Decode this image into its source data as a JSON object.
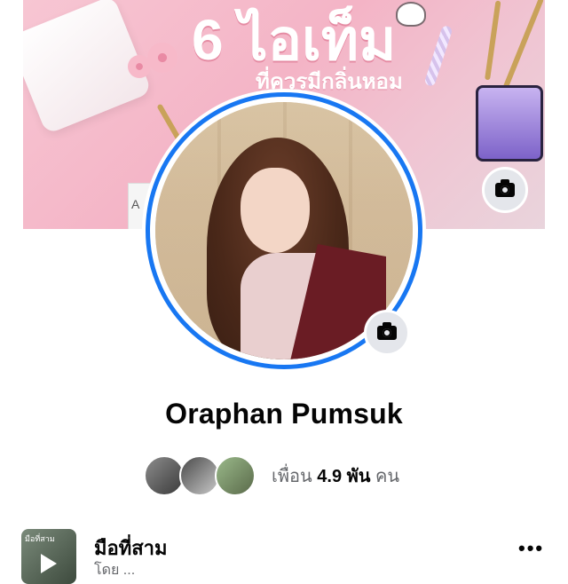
{
  "cover": {
    "headline": "6 ไอเท็ม",
    "subline": "ที่ควรมีกลิ่นหอม",
    "card_text": "A"
  },
  "profile": {
    "name": "Oraphan Pumsuk"
  },
  "friends": {
    "prefix": "เพื่อน",
    "count": "4.9 พัน",
    "suffix": "คน"
  },
  "post": {
    "title": "มือที่สาม",
    "subtitle": "โดย ...",
    "thumb_label": "มือที่สาม"
  },
  "icons": {
    "cover_camera": "camera-icon",
    "avatar_camera": "camera-icon",
    "more": "more-horizontal-icon",
    "play": "play-icon"
  },
  "colors": {
    "accent": "#1877f2",
    "camera_bg": "#e4e6eb",
    "secondary_text": "#65676b"
  }
}
